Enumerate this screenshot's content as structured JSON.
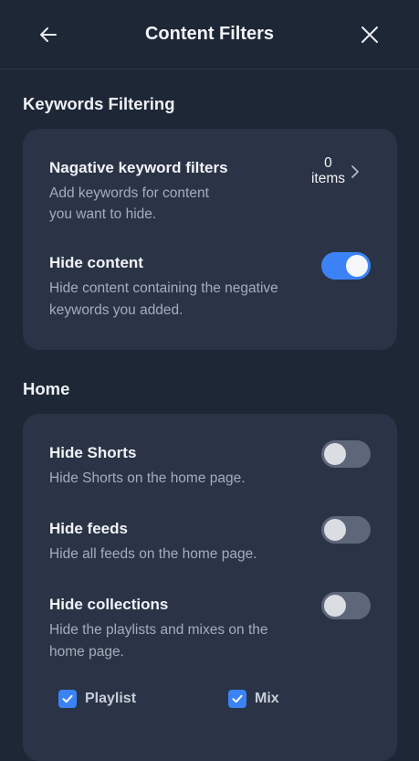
{
  "header": {
    "title": "Content Filters",
    "back_icon": "arrow-left-icon",
    "close_icon": "close-icon"
  },
  "keywords_section": {
    "title": "Keywords Filtering",
    "negative_filters": {
      "title": "Nagative keyword filters",
      "description_line1": "Add keywords for content",
      "description_line2": "you want to hide.",
      "count": "0",
      "count_unit": "items"
    },
    "hide_content": {
      "title": "Hide content",
      "description_line1": "Hide content containing the negative",
      "description_line2": "keywords you added.",
      "enabled": true
    }
  },
  "home_section": {
    "title": "Home",
    "hide_shorts": {
      "title": "Hide Shorts",
      "description": "Hide Shorts on the home page.",
      "enabled": false
    },
    "hide_feeds": {
      "title": "Hide feeds",
      "description": "Hide all feeds on the home page.",
      "enabled": false
    },
    "hide_collections": {
      "title": "Hide collections",
      "description_line1": "Hide the playlists and mixes on the",
      "description_line2": "home page.",
      "enabled": false
    },
    "options": [
      {
        "label": "Playlist",
        "checked": true
      },
      {
        "label": "Mix",
        "checked": true
      }
    ]
  },
  "colors": {
    "background": "#1e2736",
    "card": "#2a3446",
    "accent": "#3b82f6",
    "toggle_off": "#5d6779"
  }
}
